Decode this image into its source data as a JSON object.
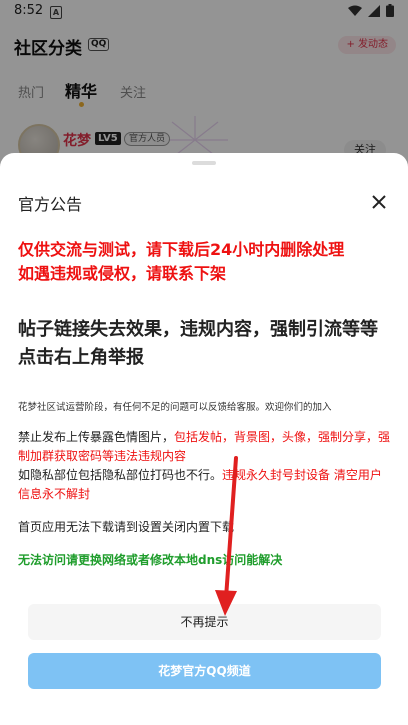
{
  "status_bar": {
    "time": "8:52",
    "app_icon": "A"
  },
  "header": {
    "title": "社区分类",
    "qq_label": "QQ",
    "post_button": "+ 发动态"
  },
  "tabs": [
    {
      "label": "热门"
    },
    {
      "label": "精华"
    },
    {
      "label": "关注"
    }
  ],
  "post": {
    "username": "花梦",
    "level": "LV5",
    "role": "官方人员",
    "follow_label": "关注"
  },
  "dialog": {
    "title": "官方公告",
    "warning_line1": "仅供交流与测试，请下载后24小时内删除处理",
    "warning_line2": "如遇违规或侵权，请联系下架",
    "report_notice": "帖子链接失去效果，违规内容，强制引流等等点击右上角举报",
    "intro": "花梦社区试运营阶段，有任何不足的问题可以反馈给客服。欢迎你们的加入",
    "rule1_black": "禁止发布上传暴露色情图片，",
    "rule1_red": "包括发帖，背景图，头像，强制分享，强制加群获取密码等违法违规内容",
    "rule2_black": "如隐私部位包括隐私部位打码也不行。",
    "rule2_red": "违规永久封号封设备 清空用户信息永不解封",
    "download_notice": "首页应用无法下载请到设置关闭内置下载",
    "network_notice": "无法访问请更换网络或者修改本地dns访问能解决",
    "dismiss_button": "不再提示",
    "channel_button": "花梦官方QQ频道"
  },
  "colors": {
    "warning_red": "#ee1111",
    "green": "#1f9d2c",
    "channel_button": "#7ec2f4",
    "annotation_red": "#e02020"
  },
  "icons": [
    "wifi-icon",
    "signal-icon",
    "battery-icon",
    "close-icon",
    "arrow-annotation-icon"
  ]
}
